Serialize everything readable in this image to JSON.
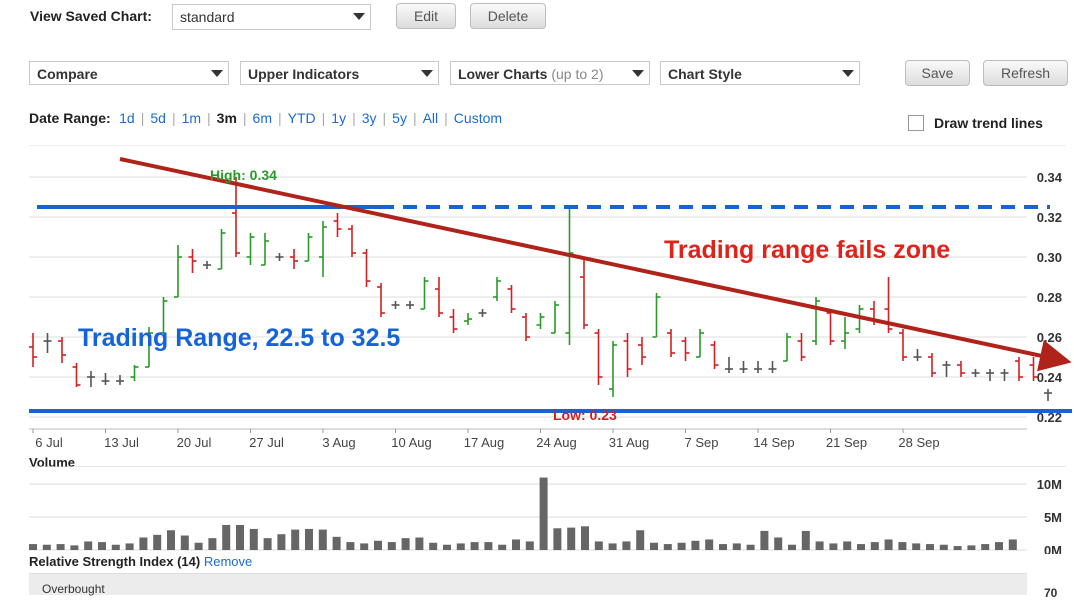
{
  "toolbar": {
    "view_saved_label": "View Saved Chart:",
    "saved_chart_value": "standard",
    "edit_label": "Edit",
    "delete_label": "Delete"
  },
  "controls": {
    "compare": "Compare",
    "upper_indicators": "Upper Indicators",
    "lower_charts": "Lower Charts",
    "lower_charts_hint": "(up to 2)",
    "chart_style": "Chart Style",
    "save_label": "Save",
    "refresh_label": "Refresh"
  },
  "date_range": {
    "label": "Date Range:",
    "options": [
      "1d",
      "5d",
      "1m",
      "3m",
      "6m",
      "YTD",
      "1y",
      "3y",
      "5y",
      "All",
      "Custom"
    ],
    "selected": "3m"
  },
  "trend_lines_label": "Draw trend lines",
  "annotations": {
    "high": "High: 0.34",
    "low": "Low: 0.23",
    "trading_range": "Trading Range, 22.5 to 32.5",
    "fails_zone": "Trading range fails zone"
  },
  "colors": {
    "up": "#2a9a2a",
    "down": "#d42020",
    "flat": "#555555",
    "range_line": "#1464d8",
    "trend_line": "#b0231a",
    "high_label": "#2a9a2a",
    "low_label": "#d42020",
    "volume_bar": "#666666",
    "link": "#1a6ccf"
  },
  "chart_data": {
    "type": "bar",
    "title": "",
    "y_ticks": [
      "0.34",
      "0.32",
      "0.30",
      "0.28",
      "0.26",
      "0.24",
      "0.22"
    ],
    "ylim": [
      0.22,
      0.34
    ],
    "x_tick_labels": [
      "6 Jul",
      "13 Jul",
      "20 Jul",
      "27 Jul",
      "3 Aug",
      "10 Aug",
      "17 Aug",
      "24 Aug",
      "31 Aug",
      "7 Sep",
      "14 Sep",
      "21 Sep",
      "28 Sep"
    ],
    "bars": [
      {
        "d": 0,
        "o": 0.255,
        "h": 0.262,
        "l": 0.245,
        "c": 0.25
      },
      {
        "d": 1,
        "o": 0.258,
        "h": 0.262,
        "l": 0.252,
        "c": 0.258
      },
      {
        "d": 2,
        "o": 0.258,
        "h": 0.26,
        "l": 0.247,
        "c": 0.251
      },
      {
        "d": 3,
        "o": 0.245,
        "h": 0.247,
        "l": 0.235,
        "c": 0.236
      },
      {
        "d": 4,
        "o": 0.24,
        "h": 0.243,
        "l": 0.235,
        "c": 0.24
      },
      {
        "d": 5,
        "o": 0.238,
        "h": 0.242,
        "l": 0.236,
        "c": 0.238
      },
      {
        "d": 6,
        "o": 0.238,
        "h": 0.241,
        "l": 0.236,
        "c": 0.238
      },
      {
        "d": 7,
        "o": 0.24,
        "h": 0.246,
        "l": 0.238,
        "c": 0.245
      },
      {
        "d": 8,
        "o": 0.245,
        "h": 0.265,
        "l": 0.245,
        "c": 0.262
      },
      {
        "d": 9,
        "o": 0.262,
        "h": 0.28,
        "l": 0.262,
        "c": 0.278
      },
      {
        "d": 10,
        "o": 0.28,
        "h": 0.306,
        "l": 0.28,
        "c": 0.3
      },
      {
        "d": 11,
        "o": 0.3,
        "h": 0.304,
        "l": 0.292,
        "c": 0.298
      },
      {
        "d": 12,
        "o": 0.296,
        "h": 0.298,
        "l": 0.294,
        "c": 0.296
      },
      {
        "d": 13,
        "o": 0.294,
        "h": 0.314,
        "l": 0.294,
        "c": 0.312
      },
      {
        "d": 14,
        "o": 0.322,
        "h": 0.34,
        "l": 0.3,
        "c": 0.302
      },
      {
        "d": 15,
        "o": 0.3,
        "h": 0.312,
        "l": 0.296,
        "c": 0.31
      },
      {
        "d": 16,
        "o": 0.296,
        "h": 0.312,
        "l": 0.296,
        "c": 0.308
      },
      {
        "d": 17,
        "o": 0.3,
        "h": 0.302,
        "l": 0.298,
        "c": 0.3
      },
      {
        "d": 18,
        "o": 0.3,
        "h": 0.304,
        "l": 0.294,
        "c": 0.298
      },
      {
        "d": 19,
        "o": 0.298,
        "h": 0.312,
        "l": 0.298,
        "c": 0.31
      },
      {
        "d": 20,
        "o": 0.3,
        "h": 0.318,
        "l": 0.29,
        "c": 0.315
      },
      {
        "d": 21,
        "o": 0.318,
        "h": 0.322,
        "l": 0.31,
        "c": 0.314
      },
      {
        "d": 22,
        "o": 0.314,
        "h": 0.316,
        "l": 0.3,
        "c": 0.302
      },
      {
        "d": 23,
        "o": 0.302,
        "h": 0.304,
        "l": 0.285,
        "c": 0.288
      },
      {
        "d": 24,
        "o": 0.285,
        "h": 0.287,
        "l": 0.27,
        "c": 0.272
      },
      {
        "d": 25,
        "o": 0.276,
        "h": 0.278,
        "l": 0.274,
        "c": 0.276
      },
      {
        "d": 26,
        "o": 0.276,
        "h": 0.278,
        "l": 0.274,
        "c": 0.276
      },
      {
        "d": 27,
        "o": 0.274,
        "h": 0.29,
        "l": 0.274,
        "c": 0.288
      },
      {
        "d": 28,
        "o": 0.284,
        "h": 0.29,
        "l": 0.27,
        "c": 0.272
      },
      {
        "d": 29,
        "o": 0.27,
        "h": 0.274,
        "l": 0.262,
        "c": 0.264
      },
      {
        "d": 30,
        "o": 0.268,
        "h": 0.272,
        "l": 0.266,
        "c": 0.269
      },
      {
        "d": 31,
        "o": 0.272,
        "h": 0.274,
        "l": 0.27,
        "c": 0.272
      },
      {
        "d": 32,
        "o": 0.28,
        "h": 0.29,
        "l": 0.278,
        "c": 0.288
      },
      {
        "d": 33,
        "o": 0.284,
        "h": 0.286,
        "l": 0.272,
        "c": 0.274
      },
      {
        "d": 34,
        "o": 0.27,
        "h": 0.272,
        "l": 0.258,
        "c": 0.26
      },
      {
        "d": 35,
        "o": 0.266,
        "h": 0.272,
        "l": 0.264,
        "c": 0.27
      },
      {
        "d": 36,
        "o": 0.262,
        "h": 0.278,
        "l": 0.262,
        "c": 0.276
      },
      {
        "d": 37,
        "o": 0.262,
        "h": 0.324,
        "l": 0.256,
        "c": 0.302
      },
      {
        "d": 38,
        "o": 0.29,
        "h": 0.3,
        "l": 0.264,
        "c": 0.266
      },
      {
        "d": 39,
        "o": 0.262,
        "h": 0.264,
        "l": 0.236,
        "c": 0.24
      },
      {
        "d": 40,
        "o": 0.234,
        "h": 0.258,
        "l": 0.23,
        "c": 0.256
      },
      {
        "d": 41,
        "o": 0.258,
        "h": 0.262,
        "l": 0.24,
        "c": 0.244
      },
      {
        "d": 42,
        "o": 0.256,
        "h": 0.26,
        "l": 0.246,
        "c": 0.25
      },
      {
        "d": 43,
        "o": 0.26,
        "h": 0.282,
        "l": 0.26,
        "c": 0.28
      },
      {
        "d": 44,
        "o": 0.262,
        "h": 0.264,
        "l": 0.25,
        "c": 0.252
      },
      {
        "d": 45,
        "o": 0.258,
        "h": 0.26,
        "l": 0.248,
        "c": 0.252
      },
      {
        "d": 46,
        "o": 0.25,
        "h": 0.264,
        "l": 0.25,
        "c": 0.262
      },
      {
        "d": 47,
        "o": 0.256,
        "h": 0.258,
        "l": 0.244,
        "c": 0.246
      },
      {
        "d": 48,
        "o": 0.244,
        "h": 0.25,
        "l": 0.242,
        "c": 0.244
      },
      {
        "d": 49,
        "o": 0.244,
        "h": 0.248,
        "l": 0.242,
        "c": 0.244
      },
      {
        "d": 50,
        "o": 0.244,
        "h": 0.248,
        "l": 0.242,
        "c": 0.244
      },
      {
        "d": 51,
        "o": 0.244,
        "h": 0.248,
        "l": 0.242,
        "c": 0.244
      },
      {
        "d": 52,
        "o": 0.248,
        "h": 0.262,
        "l": 0.248,
        "c": 0.26
      },
      {
        "d": 53,
        "o": 0.258,
        "h": 0.262,
        "l": 0.248,
        "c": 0.25
      },
      {
        "d": 54,
        "o": 0.258,
        "h": 0.28,
        "l": 0.256,
        "c": 0.278
      },
      {
        "d": 55,
        "o": 0.272,
        "h": 0.274,
        "l": 0.256,
        "c": 0.258
      },
      {
        "d": 56,
        "o": 0.258,
        "h": 0.27,
        "l": 0.254,
        "c": 0.262
      },
      {
        "d": 57,
        "o": 0.264,
        "h": 0.276,
        "l": 0.262,
        "c": 0.274
      },
      {
        "d": 58,
        "o": 0.274,
        "h": 0.278,
        "l": 0.266,
        "c": 0.268
      },
      {
        "d": 59,
        "o": 0.274,
        "h": 0.29,
        "l": 0.262,
        "c": 0.264
      },
      {
        "d": 60,
        "o": 0.262,
        "h": 0.264,
        "l": 0.248,
        "c": 0.25
      },
      {
        "d": 61,
        "o": 0.25,
        "h": 0.254,
        "l": 0.248,
        "c": 0.25
      },
      {
        "d": 62,
        "o": 0.25,
        "h": 0.252,
        "l": 0.24,
        "c": 0.242
      },
      {
        "d": 63,
        "o": 0.246,
        "h": 0.248,
        "l": 0.24,
        "c": 0.246
      },
      {
        "d": 64,
        "o": 0.246,
        "h": 0.248,
        "l": 0.24,
        "c": 0.242
      },
      {
        "d": 65,
        "o": 0.242,
        "h": 0.244,
        "l": 0.24,
        "c": 0.242
      },
      {
        "d": 66,
        "o": 0.242,
        "h": 0.244,
        "l": 0.238,
        "c": 0.242
      },
      {
        "d": 67,
        "o": 0.242,
        "h": 0.244,
        "l": 0.238,
        "c": 0.242
      },
      {
        "d": 68,
        "o": 0.248,
        "h": 0.25,
        "l": 0.238,
        "c": 0.24
      },
      {
        "d": 69,
        "o": 0.246,
        "h": 0.25,
        "l": 0.238,
        "c": 0.24
      },
      {
        "d": 70,
        "o": 0.232,
        "h": 0.234,
        "l": 0.228,
        "c": 0.232
      }
    ],
    "range_lines": [
      0.225,
      0.325
    ],
    "volume": {
      "label": "Volume",
      "ticks": [
        "10M",
        "5M",
        "0M"
      ],
      "max": 12,
      "values": [
        0.9,
        0.8,
        0.9,
        0.7,
        1.3,
        1.2,
        0.8,
        1.0,
        1.9,
        2.3,
        3.0,
        2.2,
        1.1,
        1.8,
        3.8,
        3.8,
        3.2,
        1.8,
        2.4,
        3.1,
        3.2,
        3.1,
        2.0,
        1.2,
        1.0,
        1.4,
        1.2,
        1.8,
        1.9,
        1.1,
        0.8,
        1.0,
        1.2,
        1.2,
        0.8,
        1.6,
        1.3,
        11.0,
        3.3,
        3.4,
        3.6,
        1.3,
        1.0,
        1.3,
        3.0,
        1.1,
        0.9,
        1.1,
        1.4,
        1.6,
        0.9,
        1.0,
        0.8,
        2.9,
        1.9,
        0.8,
        2.9,
        1.3,
        1.0,
        1.3,
        0.9,
        1.2,
        1.6,
        1.2,
        1.0,
        0.9,
        0.8,
        0.6,
        0.7,
        0.9,
        1.2,
        1.6
      ]
    }
  },
  "rsi": {
    "title": "Relative Strength Index (14)",
    "remove_label": "Remove",
    "overbought_label": "Overbought",
    "tick": "70"
  }
}
